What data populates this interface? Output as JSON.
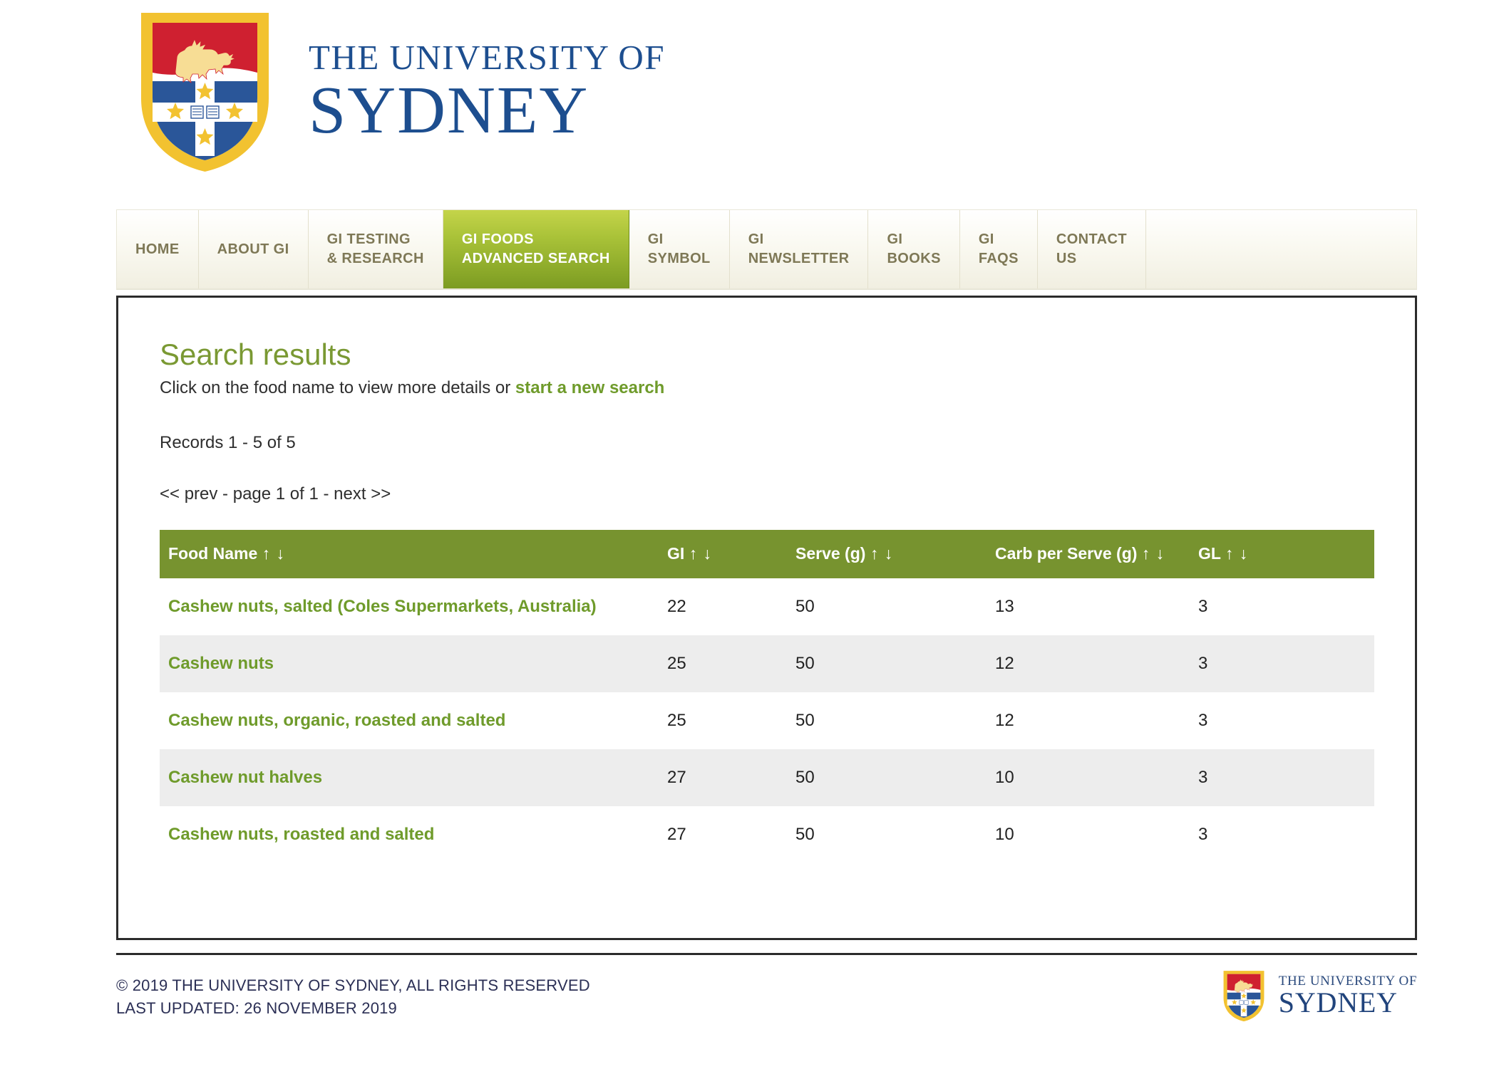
{
  "brand": {
    "logo_line1": "THE UNIVERSITY OF",
    "logo_line2": "SYDNEY",
    "crest_alt": "university-of-sydney-crest",
    "accent_green": "#77932f",
    "link_green": "#6f9b2b",
    "heading_green": "#7a9933",
    "nav_active_green": "#7c9c22",
    "navy": "#1d4e8f"
  },
  "nav": {
    "items": [
      {
        "label": "HOME",
        "active": false
      },
      {
        "label": "ABOUT GI",
        "active": false
      },
      {
        "label": "GI TESTING\n& RESEARCH",
        "active": false
      },
      {
        "label": "GI FOODS\nADVANCED SEARCH",
        "active": true
      },
      {
        "label": "GI\nSYMBOL",
        "active": false
      },
      {
        "label": "GI\nNEWSLETTER",
        "active": false
      },
      {
        "label": "GI\nBOOKS",
        "active": false
      },
      {
        "label": "GI\nFAQS",
        "active": false
      },
      {
        "label": "CONTACT\nUS",
        "active": false
      }
    ]
  },
  "main": {
    "title": "Search results",
    "subline_prefix": "Click on the food name to view more details or ",
    "subline_link": "start a new search",
    "records_line": "Records 1 - 5 of 5",
    "pager": {
      "prev": "<< prev",
      "sep1": " - ",
      "page": "page 1 of 1",
      "sep2": " - ",
      "next": "next >>"
    }
  },
  "table": {
    "sort_arrows": "↑ ↓",
    "columns": [
      {
        "key": "food",
        "label": "Food Name"
      },
      {
        "key": "gi",
        "label": "GI"
      },
      {
        "key": "serve",
        "label": "Serve (g)"
      },
      {
        "key": "carb",
        "label": "Carb per\nServe (g)"
      },
      {
        "key": "gl",
        "label": "GL"
      }
    ],
    "rows": [
      {
        "food": "Cashew nuts, salted (Coles Supermarkets, Australia)",
        "gi": "22",
        "serve": "50",
        "carb": "13",
        "gl": "3"
      },
      {
        "food": "Cashew nuts",
        "gi": "25",
        "serve": "50",
        "carb": "12",
        "gl": "3"
      },
      {
        "food": "Cashew nuts, organic, roasted and salted",
        "gi": "25",
        "serve": "50",
        "carb": "12",
        "gl": "3"
      },
      {
        "food": "Cashew nut halves",
        "gi": "27",
        "serve": "50",
        "carb": "10",
        "gl": "3"
      },
      {
        "food": "Cashew nuts, roasted and salted",
        "gi": "27",
        "serve": "50",
        "carb": "10",
        "gl": "3"
      }
    ]
  },
  "footer": {
    "copyright": "© 2019 THE UNIVERSITY OF SYDNEY, ALL RIGHTS RESERVED",
    "last_updated": "LAST UPDATED: 26 NOVEMBER 2019",
    "logo_line1": "THE UNIVERSITY OF",
    "logo_line2": "SYDNEY"
  }
}
